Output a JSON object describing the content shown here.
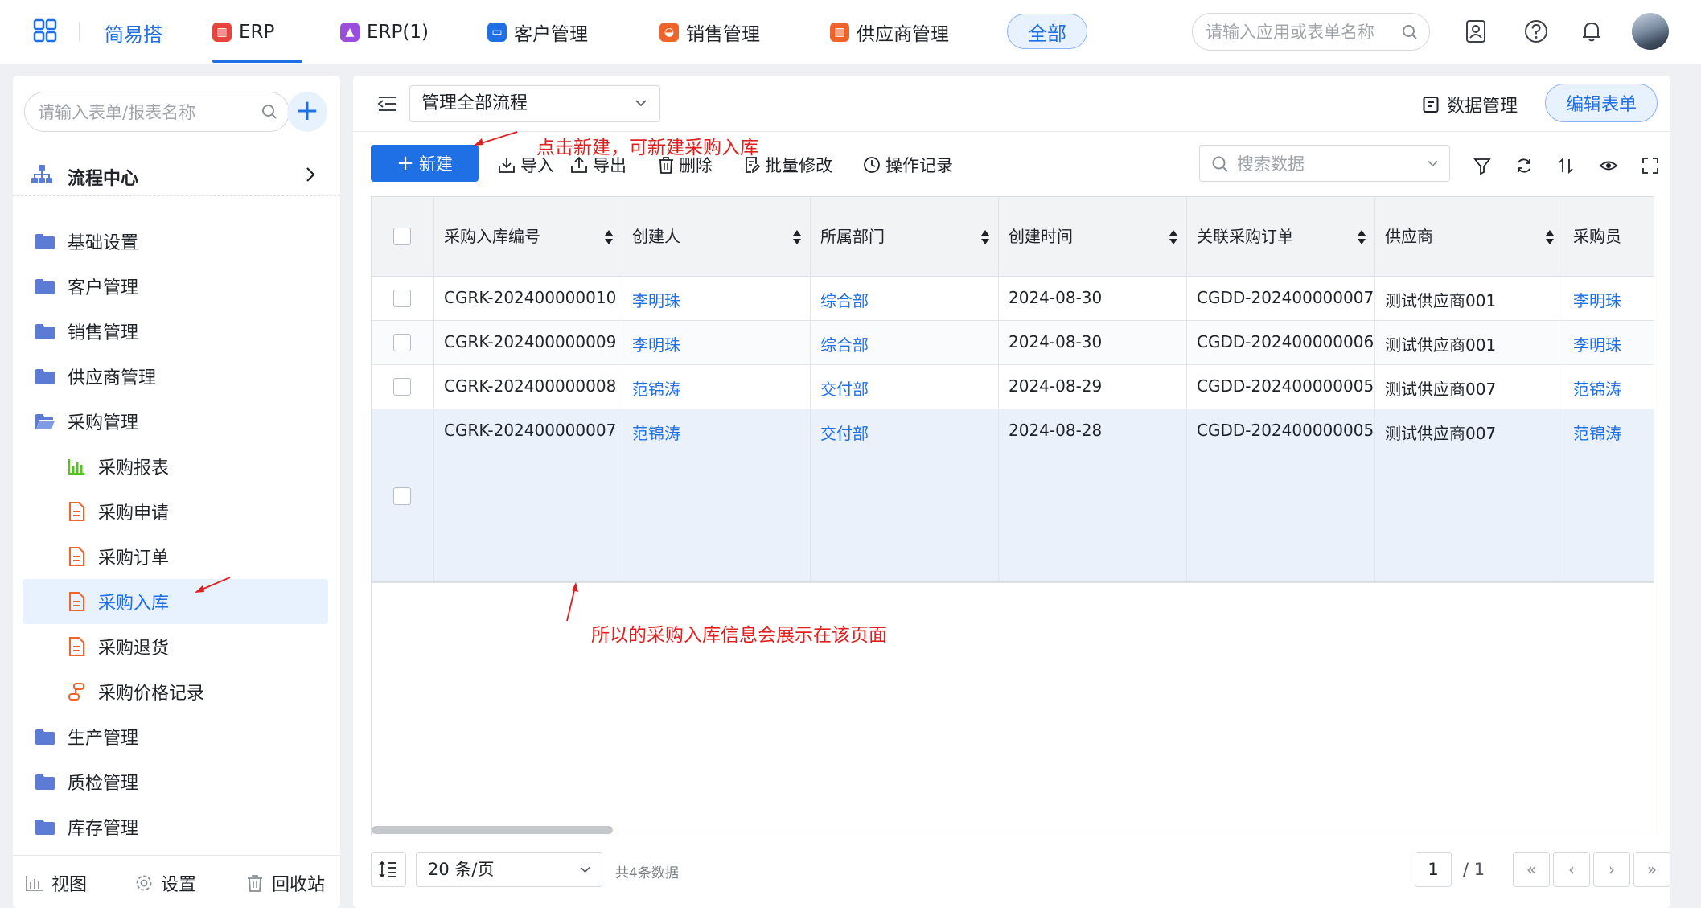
{
  "topnav": {
    "brand": "简易搭",
    "tabs": [
      {
        "label": "ERP",
        "icon": "erp-app-icon",
        "color": "#e6443d"
      },
      {
        "label": "ERP(1)",
        "icon": "erp1-app-icon",
        "color": "#9b4ede"
      },
      {
        "label": "客户管理",
        "icon": "customer-app-icon",
        "color": "#1f6fe5"
      },
      {
        "label": "销售管理",
        "icon": "sales-app-icon",
        "color": "#f0642c"
      },
      {
        "label": "供应商管理",
        "icon": "supplier-app-icon",
        "color": "#f0642c"
      }
    ],
    "all_label": "全部",
    "search_placeholder": "请输入应用或表单名称"
  },
  "sidebar": {
    "search_placeholder": "请输入表单/报表名称",
    "flow_center": "流程中心",
    "items": [
      {
        "label": "基础设置",
        "type": "folder"
      },
      {
        "label": "客户管理",
        "type": "folder"
      },
      {
        "label": "销售管理",
        "type": "folder"
      },
      {
        "label": "供应商管理",
        "type": "folder"
      },
      {
        "label": "采购管理",
        "type": "folder-open"
      },
      {
        "label": "采购报表",
        "type": "report"
      },
      {
        "label": "采购申请",
        "type": "form"
      },
      {
        "label": "采购订单",
        "type": "form"
      },
      {
        "label": "采购入库",
        "type": "form",
        "selected": true
      },
      {
        "label": "采购退货",
        "type": "form"
      },
      {
        "label": "采购价格记录",
        "type": "flow"
      },
      {
        "label": "生产管理",
        "type": "folder"
      },
      {
        "label": "质检管理",
        "type": "folder"
      },
      {
        "label": "库存管理",
        "type": "folder"
      }
    ],
    "footer": {
      "view": "视图",
      "settings": "设置",
      "recycle": "回收站"
    }
  },
  "main": {
    "flow_select": "管理全部流程",
    "data_mgmt": "数据管理",
    "edit_form": "编辑表单",
    "toolbar": {
      "new": "新建",
      "import": "导入",
      "export": "导出",
      "delete": "删除",
      "batch_edit": "批量修改",
      "op_log": "操作记录",
      "search_placeholder": "搜索数据"
    },
    "annotations": {
      "new_hint": "点击新建，可新建采购入库",
      "page_hint": "所以的采购入库信息会展示在该页面"
    },
    "table": {
      "columns": [
        "采购入库编号",
        "创建人",
        "所属部门",
        "创建时间",
        "关联采购订单",
        "供应商",
        "采购员"
      ],
      "rows": [
        [
          "CGRK-202400000010",
          "李明珠",
          "综合部",
          "2024-08-30",
          "CGDD-202400000007",
          "测试供应商001",
          "李明珠"
        ],
        [
          "CGRK-202400000009",
          "李明珠",
          "综合部",
          "2024-08-30",
          "CGDD-202400000006",
          "测试供应商001",
          "李明珠"
        ],
        [
          "CGRK-202400000008",
          "范锦涛",
          "交付部",
          "2024-08-29",
          "CGDD-202400000005",
          "测试供应商007",
          "范锦涛"
        ],
        [
          "CGRK-202400000007",
          "范锦涛",
          "交付部",
          "2024-08-28",
          "CGDD-202400000005",
          "测试供应商007",
          "范锦涛"
        ]
      ]
    },
    "pager": {
      "page_size": "20 条/页",
      "total": "共4条数据",
      "current": "1",
      "pages": "/ 1"
    }
  },
  "colors": {
    "accent": "#1f6fe5",
    "annotation": "#e02020",
    "folder": "#5b7bd5",
    "form_icon": "#f0642c",
    "report_icon": "#52c41a"
  }
}
